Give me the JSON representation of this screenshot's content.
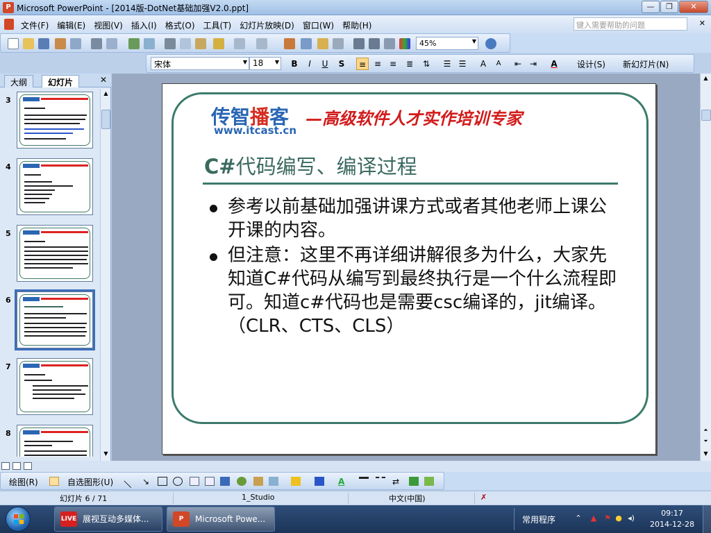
{
  "window": {
    "title": "Microsoft PowerPoint - [2014版-DotNet基础加强V2.0.ppt]",
    "buttons": [
      "—",
      "❐",
      "✕"
    ]
  },
  "menu": {
    "items": [
      "文件(F)",
      "编辑(E)",
      "视图(V)",
      "插入(I)",
      "格式(O)",
      "工具(T)",
      "幻灯片放映(D)",
      "窗口(W)",
      "帮助(H)"
    ],
    "help_placeholder": "键入需要帮助的问题",
    "close": "✕"
  },
  "toolbar": {
    "zoom": "45%"
  },
  "format_toolbar": {
    "font": "宋体",
    "size": "18",
    "bold": "B",
    "italic": "I",
    "underline": "U",
    "shadow": "S",
    "design": "设计(S)",
    "new_slide": "新幻灯片(N)"
  },
  "outline_pane": {
    "tabs": [
      "大纲",
      "幻灯片"
    ],
    "close": "✕",
    "slide_numbers": [
      "3",
      "4",
      "5",
      "6",
      "7",
      "8"
    ],
    "selected_slide": "6"
  },
  "slide": {
    "logo_text_1": "传智",
    "logo_text_2": "播",
    "logo_text_3": "客",
    "logo_url": "www.itcast.cn",
    "slogan": "—高级软件人才实作培训专家",
    "title_bold": "C#",
    "title_rest": "代码编写、编译过程",
    "bullets": [
      "参考以前基础加强讲课方式或者其他老师上课公开课的内容。",
      "但注意：这里不再详细讲解很多为什么，大家先知道C#代码从编写到最终执行是一个什么流程即可。知道c#代码也是需要csc编译的，jit编译。（CLR、CTS、CLS）"
    ]
  },
  "drawing_toolbar": {
    "draw": "绘图(R)",
    "autoshapes": "自选图形(U)"
  },
  "statusbar": {
    "slide_pos": "幻灯片 6 / 71",
    "design_name": "1_Studio",
    "language": "中文(中国)"
  },
  "taskbar": {
    "items": [
      {
        "label": "展视互动多媒体...",
        "icon": "LIVE"
      },
      {
        "label": "Microsoft Powe...",
        "icon": "P"
      }
    ],
    "tray_label": "常用程序",
    "time": "09:17",
    "date": "2014-12-28"
  }
}
